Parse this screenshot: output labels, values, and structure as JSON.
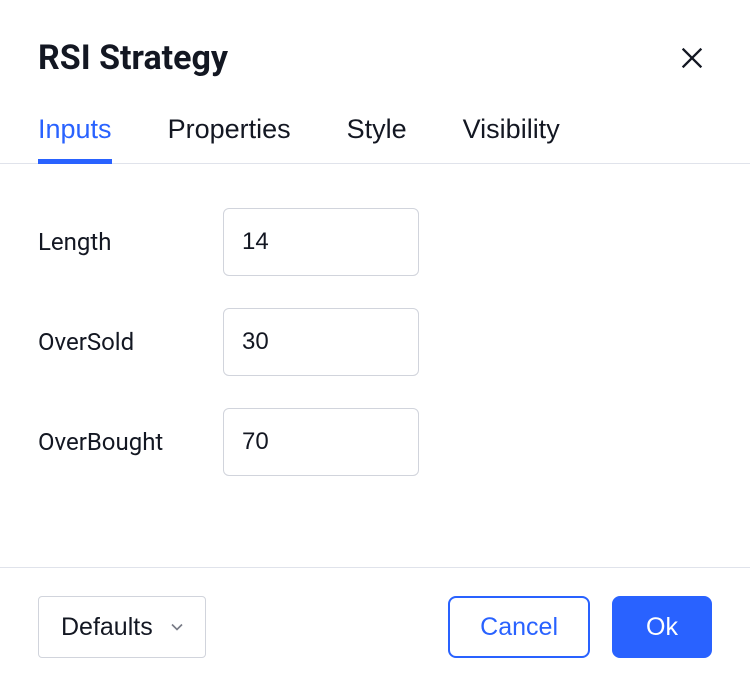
{
  "header": {
    "title": "RSI Strategy"
  },
  "tabs": {
    "items": [
      {
        "label": "Inputs",
        "active": true
      },
      {
        "label": "Properties",
        "active": false
      },
      {
        "label": "Style",
        "active": false
      },
      {
        "label": "Visibility",
        "active": false
      }
    ]
  },
  "inputs": {
    "rows": [
      {
        "label": "Length",
        "value": "14"
      },
      {
        "label": "OverSold",
        "value": "30"
      },
      {
        "label": "OverBought",
        "value": "70"
      }
    ]
  },
  "footer": {
    "defaults_label": "Defaults",
    "cancel_label": "Cancel",
    "ok_label": "Ok"
  },
  "icons": {
    "close": "close-icon",
    "chevron_down": "chevron-down-icon"
  },
  "colors": {
    "accent": "#2962ff",
    "text": "#131722",
    "border": "#d1d4dc",
    "divider": "#e0e3eb"
  }
}
